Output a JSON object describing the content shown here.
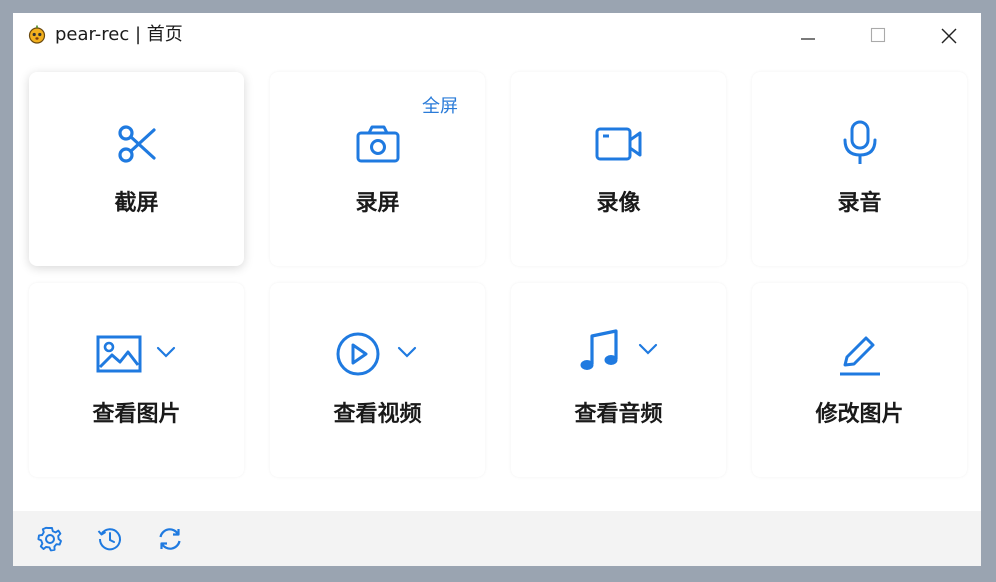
{
  "window": {
    "title": "pear-rec | 首页",
    "icon": "pear-app-icon",
    "controls": [
      "minimize-icon",
      "maximize-icon",
      "close-icon"
    ]
  },
  "accent_color": "#1f7ae0",
  "tiles": [
    {
      "label": "截屏",
      "icon": "scissors-icon"
    },
    {
      "label": "录屏",
      "icon": "camera-icon",
      "extra_link": "全屏"
    },
    {
      "label": "录像",
      "icon": "video-camera-icon"
    },
    {
      "label": "录音",
      "icon": "microphone-icon"
    },
    {
      "label": "查看图片",
      "icon": "image-icon",
      "has_dropdown": true
    },
    {
      "label": "查看视频",
      "icon": "play-circle-icon",
      "has_dropdown": true
    },
    {
      "label": "查看音频",
      "icon": "music-note-icon",
      "has_dropdown": true
    },
    {
      "label": "修改图片",
      "icon": "pencil-icon"
    }
  ],
  "bottom_bar": {
    "icons": [
      "settings-icon",
      "history-icon",
      "refresh-icon"
    ]
  }
}
